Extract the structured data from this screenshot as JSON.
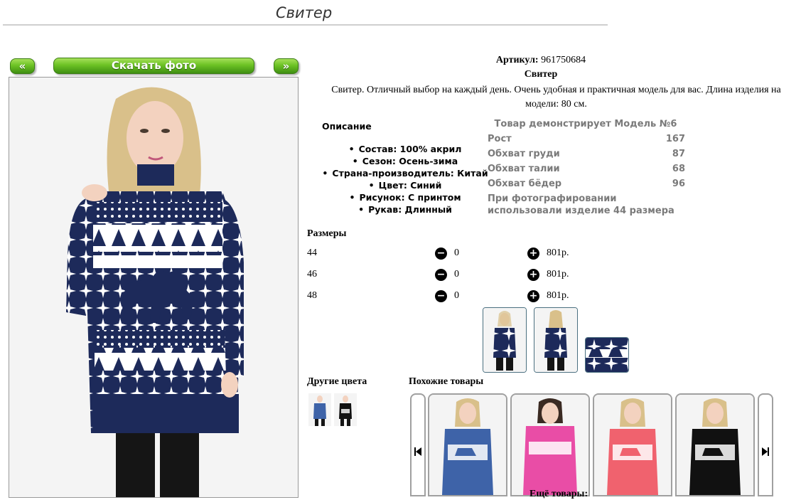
{
  "page": {
    "title": "Свитер"
  },
  "gallery": {
    "prev_label": "«",
    "next_label": "»",
    "download_label": "Скачать фото"
  },
  "product": {
    "article_label": "Артикул:",
    "article_value": "961750684",
    "name": "Свитер",
    "description": "Свитер. Отличный выбор на каждый день. Очень удобная и практичная модель для вас. Длина изделия на модели: 80 см."
  },
  "details": {
    "title": "Описание",
    "items": [
      "Состав: 100% акрил",
      "Сезон: Осень-зима",
      "Страна-производитель: Китай",
      "Цвет: Синий",
      "Рисунок: С принтом",
      "Рукав: Длинный"
    ]
  },
  "model": {
    "title": "Товар демонстрирует Модель №6",
    "rows": [
      {
        "label": "Рост",
        "value": "167"
      },
      {
        "label": "Обхват груди",
        "value": "87"
      },
      {
        "label": "Обхват талии",
        "value": "68"
      },
      {
        "label": "Обхват бёдер",
        "value": "96"
      }
    ],
    "note": "При фотографировании использовали изделие 44 размера"
  },
  "sizes": {
    "title": "Размеры",
    "rows": [
      {
        "size": "44",
        "qty": "0",
        "price": "801р."
      },
      {
        "size": "46",
        "qty": "0",
        "price": "801р."
      },
      {
        "size": "48",
        "qty": "0",
        "price": "801р."
      }
    ]
  },
  "other_colors": {
    "title": "Другие цвета"
  },
  "similar": {
    "title": "Похожие товары"
  },
  "more": {
    "label": "Ещё товары:"
  },
  "icons": {
    "minus": "minus-circle-icon",
    "plus": "plus-circle-icon",
    "prev": "skip-back-icon",
    "next": "skip-forward-icon"
  },
  "colors": {
    "accent_green": "#6cc224",
    "navy": "#1d2a5a",
    "blue_sweater": "#3e63a8",
    "pink_sweater": "#e94da6",
    "coral_sweater": "#f0626e",
    "black_sweater": "#111111"
  }
}
